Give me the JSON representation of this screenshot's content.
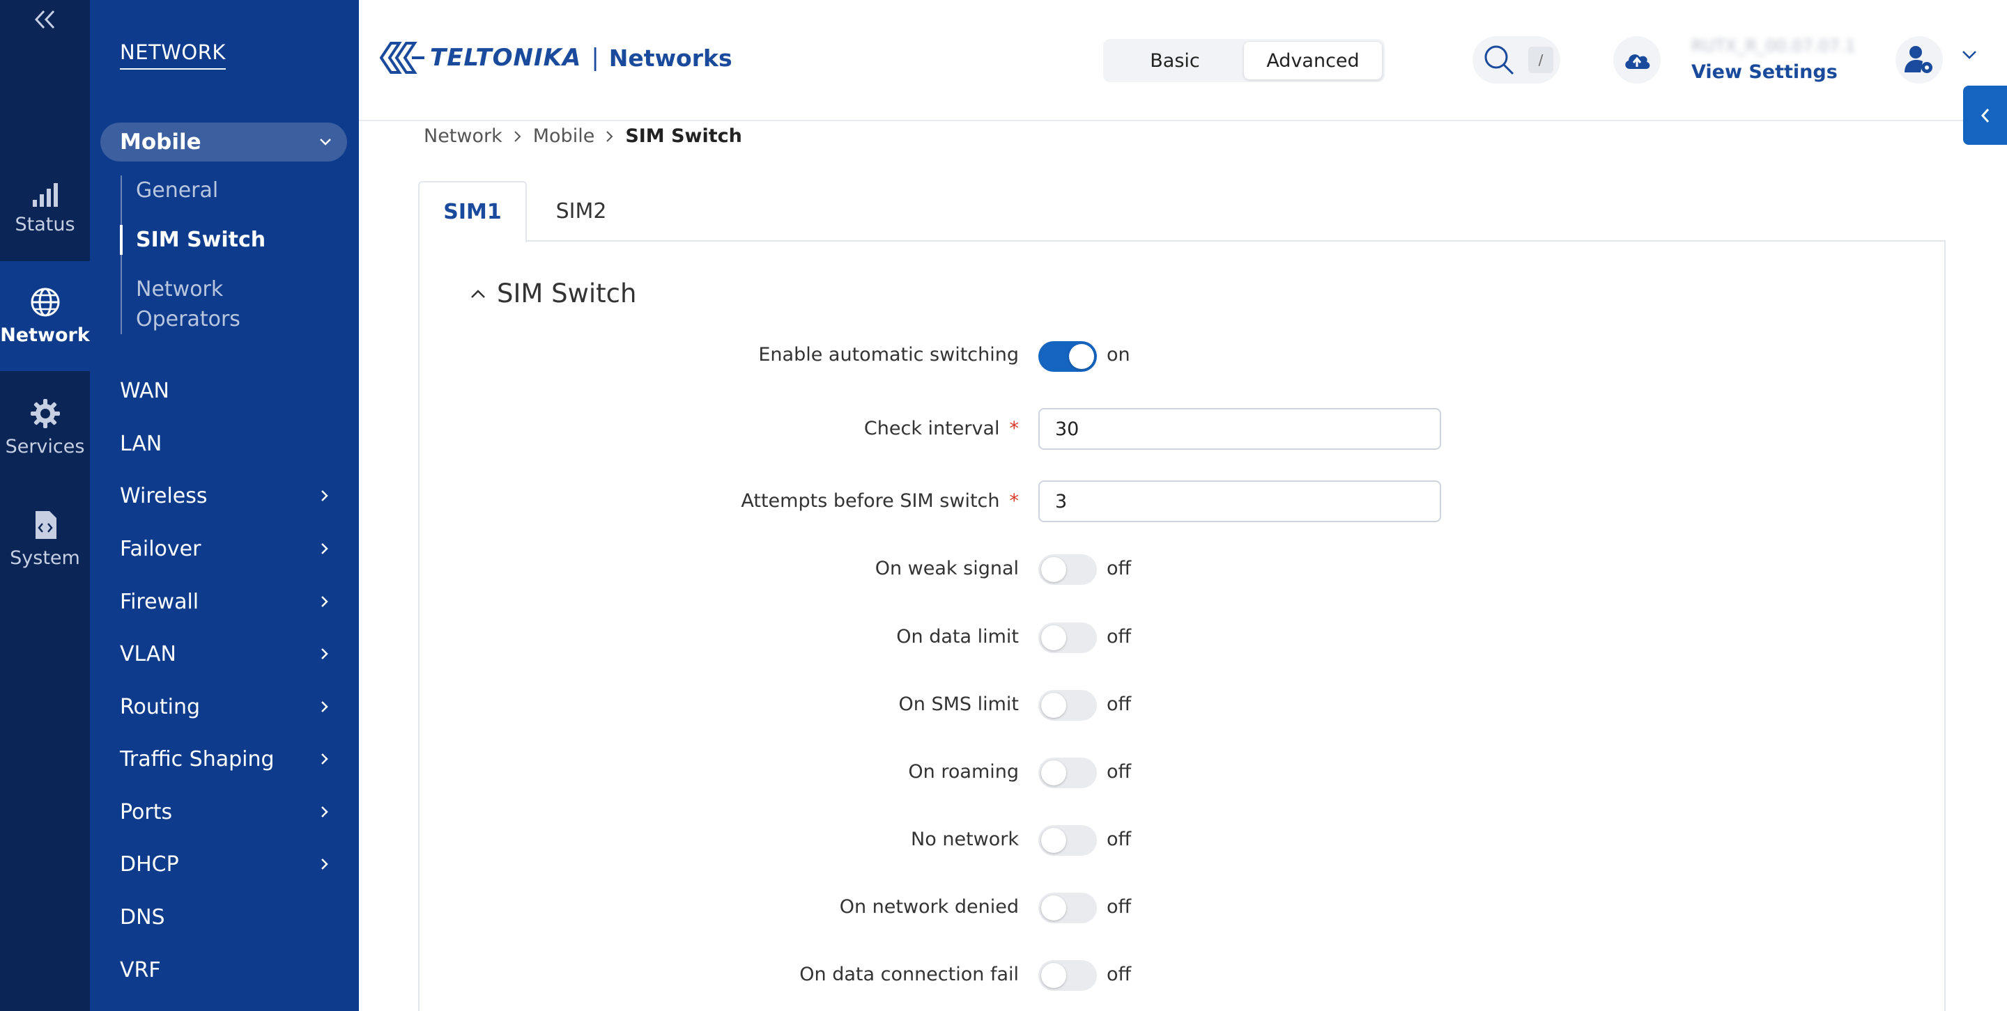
{
  "rail": {
    "items": [
      {
        "label": "Status",
        "icon": "signal-bars-icon"
      },
      {
        "label": "Network",
        "icon": "globe-icon",
        "active": true
      },
      {
        "label": "Services",
        "icon": "gear-icon"
      },
      {
        "label": "System",
        "icon": "code-file-icon"
      }
    ]
  },
  "sidebar": {
    "title": "NETWORK",
    "expanded": {
      "label": "Mobile",
      "children": [
        {
          "label": "General"
        },
        {
          "label": "SIM Switch",
          "active": true
        },
        {
          "label": "Network Operators"
        }
      ]
    },
    "items": [
      {
        "label": "WAN",
        "has_children": false
      },
      {
        "label": "LAN",
        "has_children": false
      },
      {
        "label": "Wireless",
        "has_children": true
      },
      {
        "label": "Failover",
        "has_children": true
      },
      {
        "label": "Firewall",
        "has_children": true
      },
      {
        "label": "VLAN",
        "has_children": true
      },
      {
        "label": "Routing",
        "has_children": true
      },
      {
        "label": "Traffic Shaping",
        "has_children": true
      },
      {
        "label": "Ports",
        "has_children": true
      },
      {
        "label": "DHCP",
        "has_children": true
      },
      {
        "label": "DNS",
        "has_children": false
      },
      {
        "label": "VRF",
        "has_children": false
      }
    ]
  },
  "header": {
    "brand": "TELTONIKA",
    "brand_sub": "Networks",
    "modes": [
      "Basic",
      "Advanced"
    ],
    "active_mode": "Advanced",
    "search_shortcut": "/",
    "device_id": "RUTX_R_00.07.07.1",
    "view_settings": "View Settings"
  },
  "breadcrumb": [
    "Network",
    "Mobile",
    "SIM Switch"
  ],
  "tabs": [
    "SIM1",
    "SIM2"
  ],
  "active_tab": "SIM1",
  "section": {
    "title": "SIM Switch",
    "fields": [
      {
        "label": "Enable automatic switching",
        "type": "toggle",
        "value": "on"
      },
      {
        "label": "Check interval",
        "type": "input",
        "required": true,
        "value": "30"
      },
      {
        "label": "Attempts before SIM switch",
        "type": "input",
        "required": true,
        "value": "3"
      },
      {
        "label": "On weak signal",
        "type": "toggle",
        "value": "off"
      },
      {
        "label": "On data limit",
        "type": "toggle",
        "value": "off"
      },
      {
        "label": "On SMS limit",
        "type": "toggle",
        "value": "off"
      },
      {
        "label": "On roaming",
        "type": "toggle",
        "value": "off"
      },
      {
        "label": "No network",
        "type": "toggle",
        "value": "off"
      },
      {
        "label": "On network denied",
        "type": "toggle",
        "value": "off"
      },
      {
        "label": "On data connection fail",
        "type": "toggle",
        "value": "off"
      }
    ]
  },
  "colors": {
    "rail_bg": "#0b2556",
    "sidebar_bg": "#0e3b8c",
    "accent": "#1565c0",
    "brand": "#1a4a9c",
    "required": "#d9372b"
  }
}
